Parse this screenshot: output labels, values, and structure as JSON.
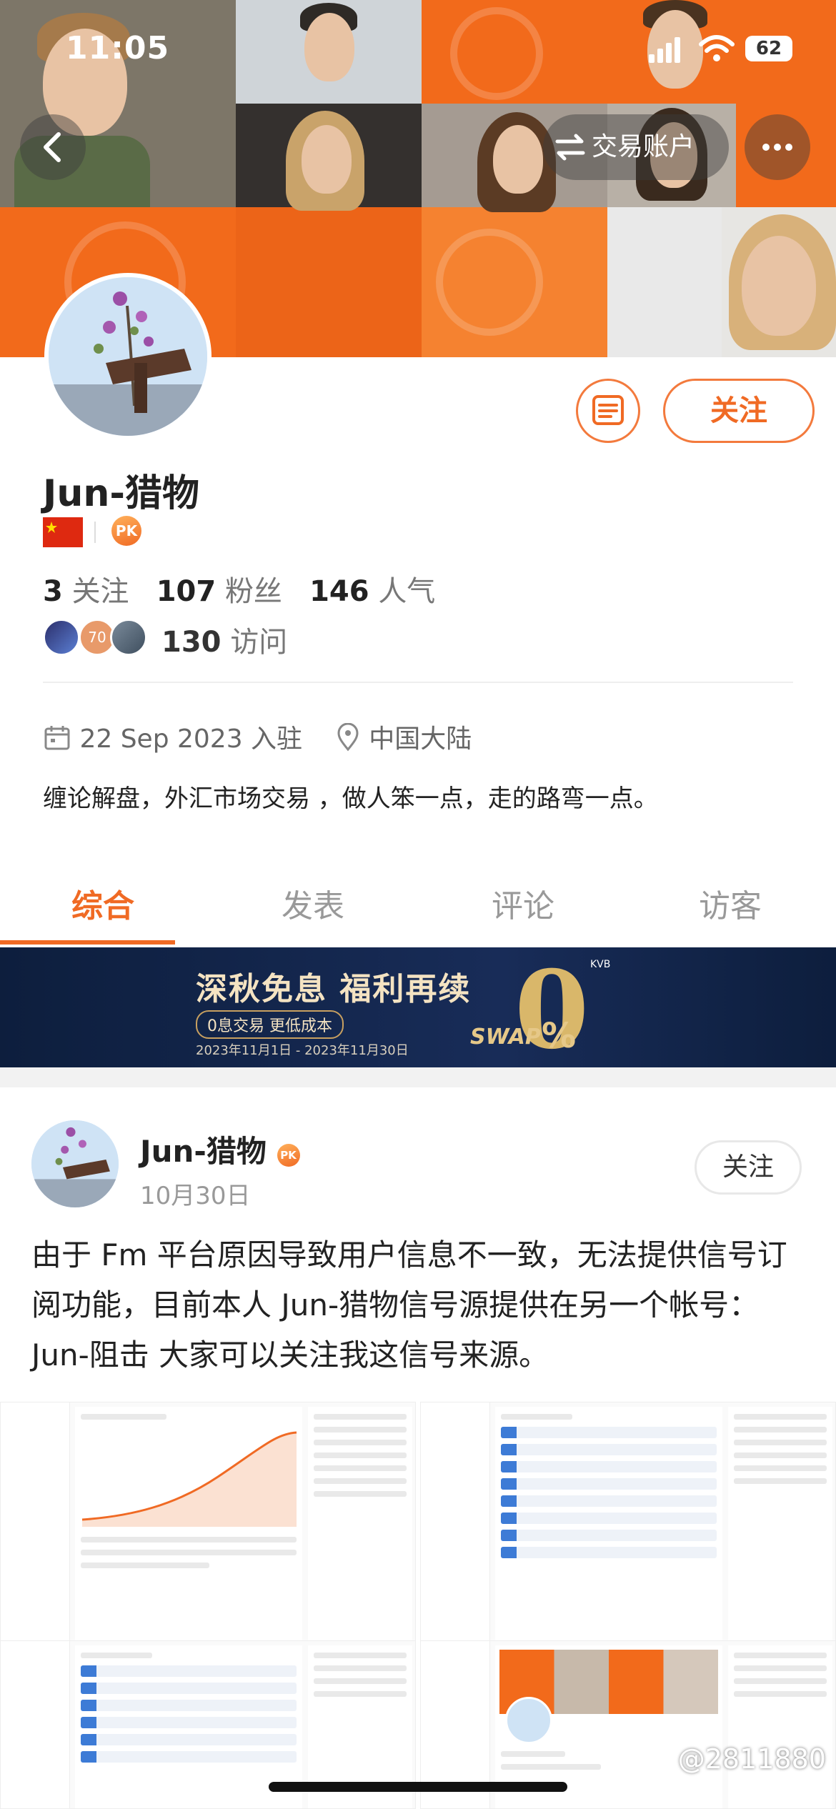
{
  "status_bar": {
    "time": "11:05",
    "battery": "62"
  },
  "header": {
    "back_icon": "chevron-left-icon",
    "trade_account_label": "交易账户",
    "more_icon": "more-horizontal-icon"
  },
  "profile": {
    "username": "Jun-猎物",
    "flag": "china-flag",
    "badge": "PK",
    "follow_label": "关注",
    "stats": {
      "following_count": "3",
      "following_label": "关注",
      "fans_count": "107",
      "fans_label": "粉丝",
      "popularity_count": "146",
      "popularity_label": "人气"
    },
    "visitor_badge": "70",
    "visits_count": "130",
    "visits_label": "访问",
    "joined": "22 Sep 2023 入驻",
    "location": "中国大陆",
    "bio": "缠论解盘，外汇市场交易 ，做人笨一点，走的路弯一点。"
  },
  "tabs": [
    {
      "label": "综合"
    },
    {
      "label": "发表"
    },
    {
      "label": "评论"
    },
    {
      "label": "访客"
    }
  ],
  "ad": {
    "title": "深秋免息 福利再续",
    "subtitle": "0息交易 更低成本",
    "date_range": "2023年11月1日 - 2023年11月30日",
    "zero": "0",
    "swap": "SWAP",
    "percent": "%",
    "brand": "KVB"
  },
  "post": {
    "username": "Jun-猎物",
    "badge": "PK",
    "date": "10月30日",
    "follow_label": "关注",
    "text": "由于 Fm 平台原因导致用户信息不一致，无法提供信号订阅功能，目前本人 Jun-猎物信号源提供在另一个帐号：Jun-阻击 大家可以关注我这信号来源。"
  },
  "watermark": "@2811880",
  "colors": {
    "accent": "#f06a24",
    "banner_orange": "#f26a1b",
    "ad_navy": "#0d1e3d"
  }
}
